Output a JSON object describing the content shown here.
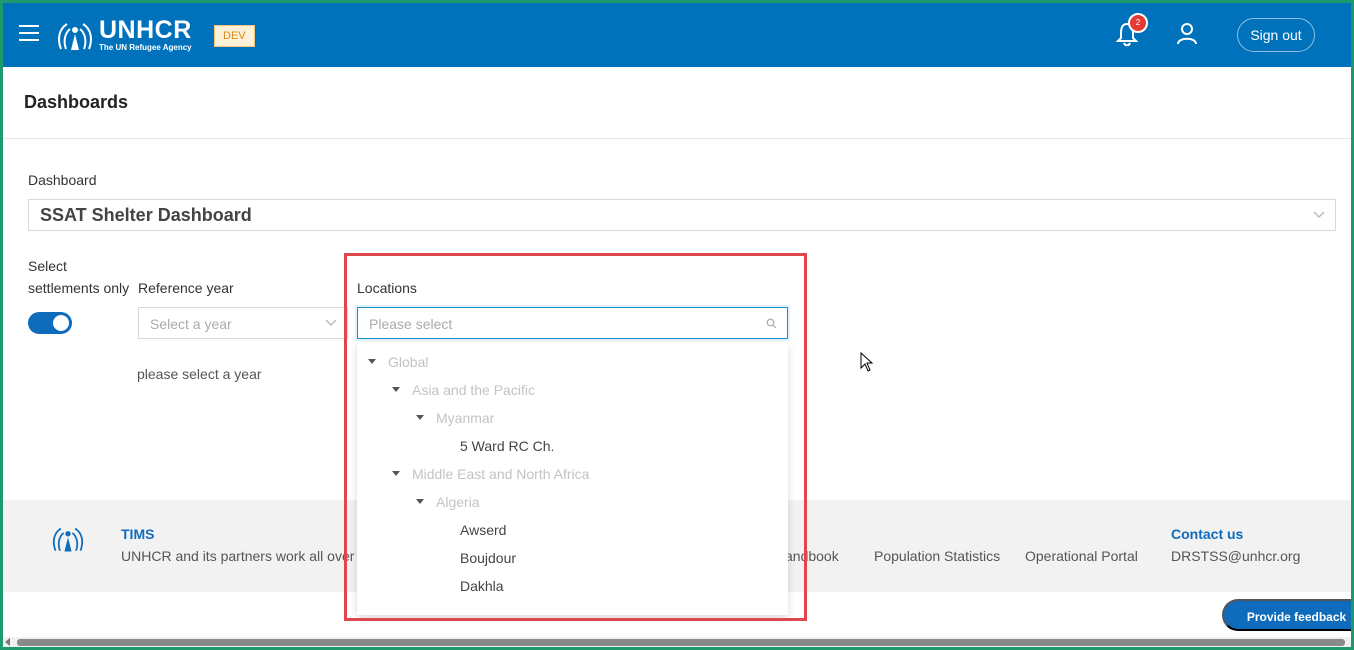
{
  "header": {
    "menu_icon": "hamburger-icon",
    "brand_name": "UNHCR",
    "brand_tagline": "The UN Refugee Agency",
    "env_badge": "DEV",
    "notification_count": "2",
    "sign_out_label": "Sign out",
    "bg_color": "#0072bc"
  },
  "page": {
    "title": "Dashboards"
  },
  "dashboard": {
    "label": "Dashboard",
    "selected": "SSAT Shelter Dashboard"
  },
  "filters": {
    "settlements_label_line1": "Select",
    "settlements_label_line2": "settlements only",
    "settlements_toggle_on": true,
    "reference_year_label": "Reference year",
    "reference_year_placeholder": "Select a year",
    "reference_year_hint": "please select a year",
    "locations_label": "Locations",
    "locations_placeholder": "Please select"
  },
  "location_tree": [
    {
      "label": "Global",
      "level": 0,
      "expanded": true,
      "disabled": true
    },
    {
      "label": "Asia and the Pacific",
      "level": 1,
      "expanded": true,
      "disabled": true
    },
    {
      "label": "Myanmar",
      "level": 2,
      "expanded": true,
      "disabled": true
    },
    {
      "label": "5 Ward RC Ch.",
      "level": 3,
      "disabled": false
    },
    {
      "label": "Middle East and North Africa",
      "level": 1,
      "expanded": true,
      "disabled": true
    },
    {
      "label": "Algeria",
      "level": 2,
      "expanded": true,
      "disabled": true
    },
    {
      "label": "Awserd",
      "level": 3,
      "disabled": false
    },
    {
      "label": "Boujdour",
      "level": 3,
      "disabled": false
    },
    {
      "label": "Dakhla",
      "level": 3,
      "disabled": false
    }
  ],
  "footer": {
    "title": "TIMS",
    "description": "UNHCR and its partners work all over t",
    "links": [
      "andbook",
      "Population Statistics",
      "Operational Portal"
    ],
    "contact_title": "Contact us",
    "contact_email": "DRSTSS@unhcr.org"
  },
  "feedback_button": "Provide feedback",
  "accent_color": "#0f6cbd"
}
